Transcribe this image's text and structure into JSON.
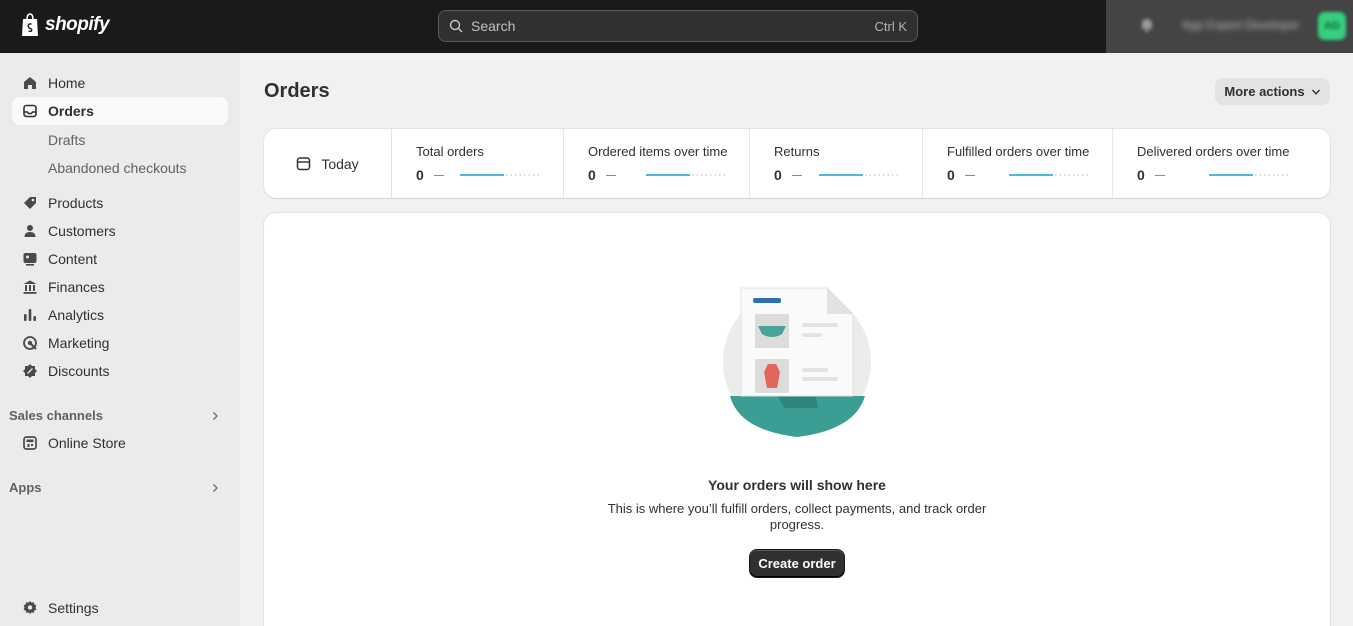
{
  "topbar": {
    "brand": "shopify",
    "search_placeholder": "Search",
    "search_shortcut": "Ctrl K",
    "user_name": "App Expert Developer",
    "avatar_initials": "AD"
  },
  "sidebar": {
    "items": [
      {
        "label": "Home",
        "icon": "home-icon"
      },
      {
        "label": "Orders",
        "icon": "orders-icon",
        "active": true
      },
      {
        "label": "Products",
        "icon": "tag-icon"
      },
      {
        "label": "Customers",
        "icon": "person-icon"
      },
      {
        "label": "Content",
        "icon": "content-icon"
      },
      {
        "label": "Finances",
        "icon": "bank-icon"
      },
      {
        "label": "Analytics",
        "icon": "bar-chart-icon"
      },
      {
        "label": "Marketing",
        "icon": "target-icon"
      },
      {
        "label": "Discounts",
        "icon": "discount-icon"
      }
    ],
    "orders_sub": [
      "Drafts",
      "Abandoned checkouts"
    ],
    "sales_channels_label": "Sales channels",
    "online_store": "Online Store",
    "apps_label": "Apps",
    "settings": "Settings"
  },
  "main": {
    "title": "Orders",
    "more_actions": "More actions",
    "date_filter": "Today",
    "metrics": [
      {
        "label": "Total orders",
        "value": "0"
      },
      {
        "label": "Ordered items over time",
        "value": "0"
      },
      {
        "label": "Returns",
        "value": "0"
      },
      {
        "label": "Fulfilled orders over time",
        "value": "0"
      },
      {
        "label": "Delivered orders over time",
        "value": "0"
      }
    ],
    "empty_title": "Your orders will show here",
    "empty_description": "This is where you’ll fulfill orders, collect payments, and track order progress.",
    "create_button": "Create order"
  },
  "colors": {
    "topbar_bg": "#1a1a1a",
    "sidebar_bg": "#ebebeb",
    "page_bg": "#f1f1f1",
    "spark_blue": "#4bb6e8",
    "illustration_teal": "#3a9e94",
    "primary_button": "#303030"
  }
}
